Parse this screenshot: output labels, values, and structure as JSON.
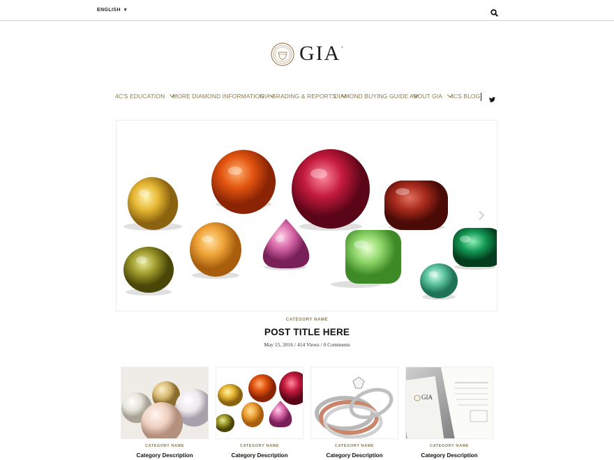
{
  "header": {
    "language": "ENGLISH",
    "search_icon": "search-icon"
  },
  "logo": {
    "wordmark": "GIA",
    "registered": "®"
  },
  "nav": {
    "items": [
      {
        "label": "4C'S EDUCATION",
        "has_dropdown": true
      },
      {
        "label": "MORE DIAMOND INFORMATION",
        "has_dropdown": true
      },
      {
        "label": "GIA GRADING & REPORTS",
        "has_dropdown": true
      },
      {
        "label": "DIAMOND BUYING GUIDE",
        "has_dropdown": true
      },
      {
        "label": "ABOUT GIA",
        "has_dropdown": true
      },
      {
        "label": "4CS BLOG",
        "has_dropdown": false
      }
    ],
    "social_icon": "twitter-icon"
  },
  "hero": {
    "image": "colored-gemstones-photo",
    "next_icon": "chevron-right-icon"
  },
  "featured": {
    "category": "CATEGORY NAME",
    "title": "POST TITLE HERE",
    "meta": "May 15, 2016 / 414 Views / 0 Comments"
  },
  "cards": [
    {
      "image": "pearls-photo",
      "category": "CATEGORY NAME",
      "description": "Category Description"
    },
    {
      "image": "gemstones-photo",
      "category": "CATEGORY NAME",
      "description": "Category Description"
    },
    {
      "image": "rings-photo",
      "category": "CATEGORY NAME",
      "description": "Category Description"
    },
    {
      "image": "gia-report-photo",
      "category": "CATEGORY NAME",
      "description": "Category Description"
    }
  ],
  "colors": {
    "accent_gold": "#8a7a4f",
    "text_dark": "#111111",
    "divider": "#cfcfcf"
  }
}
